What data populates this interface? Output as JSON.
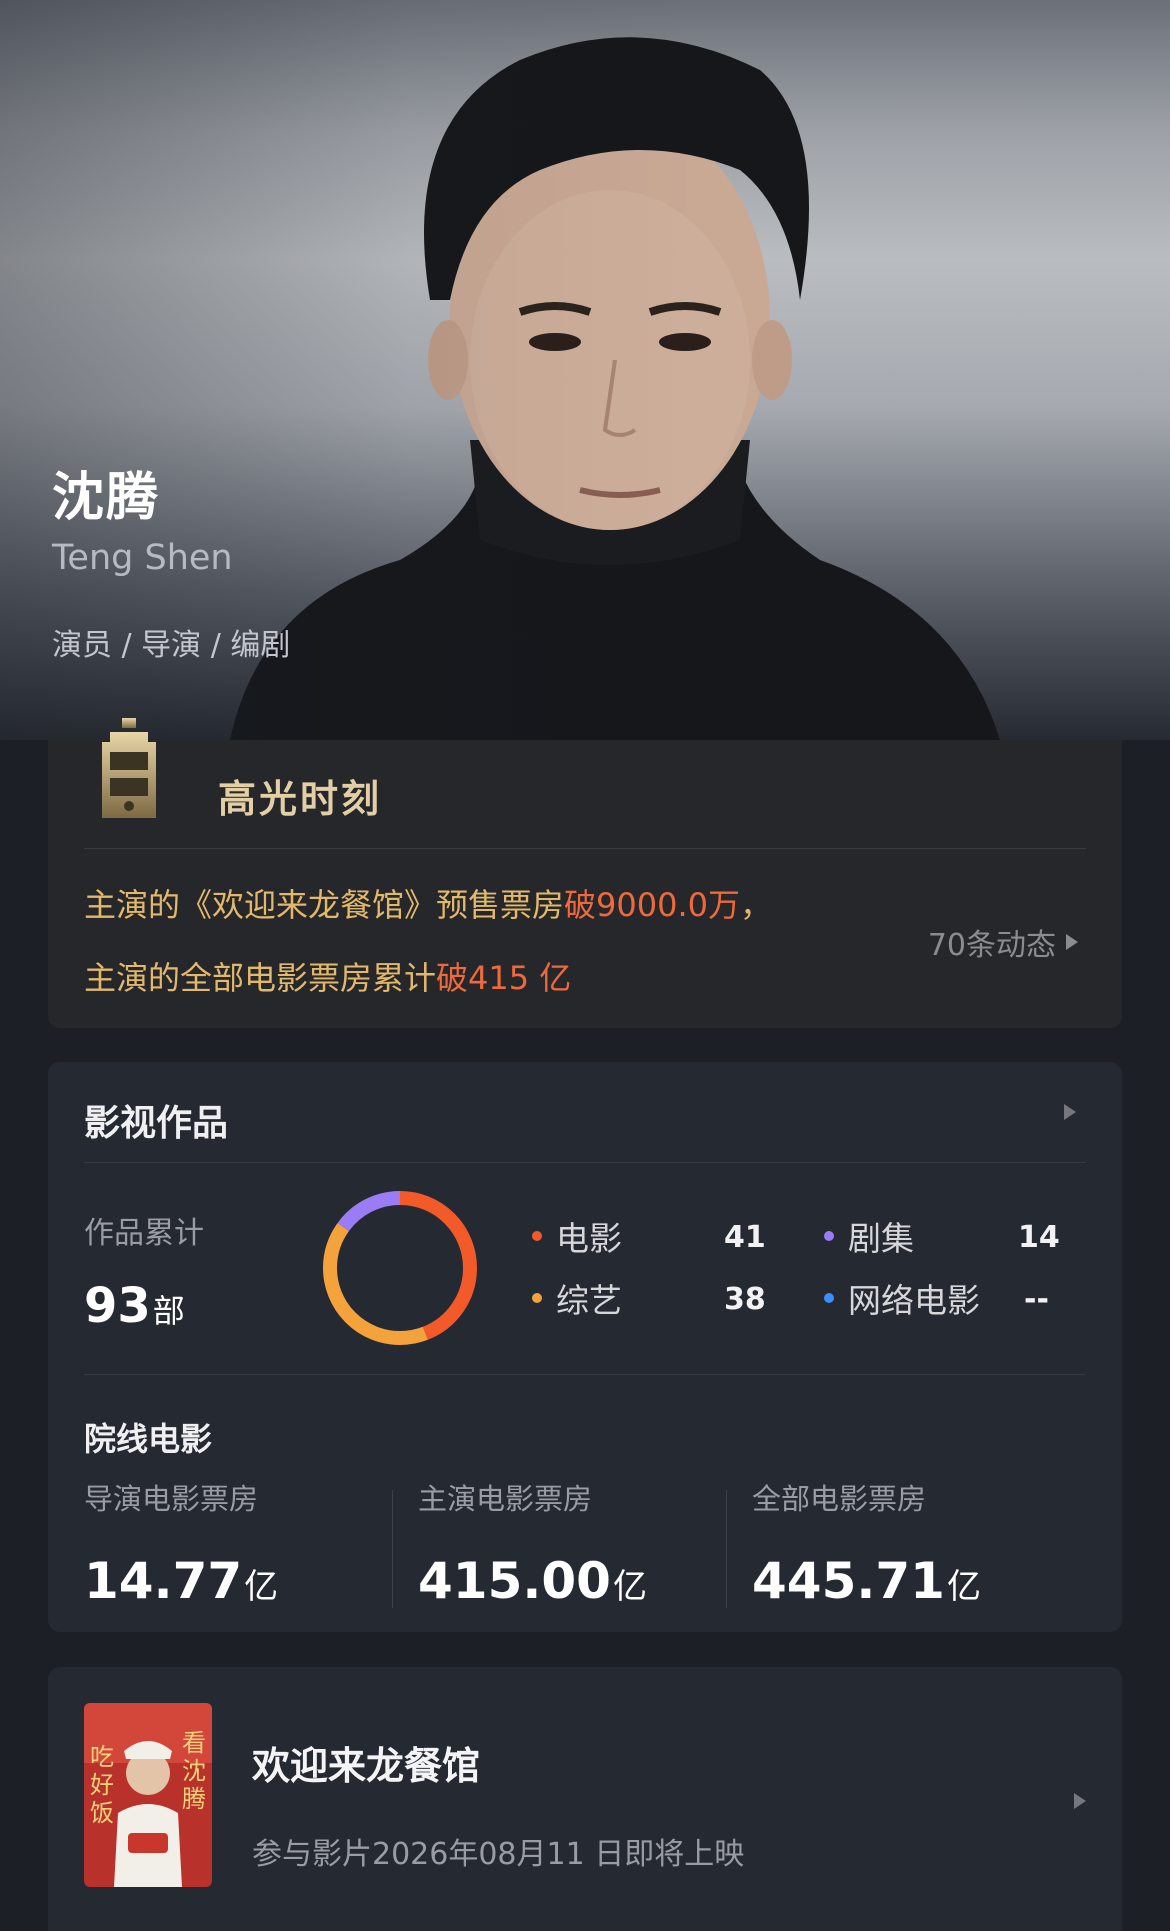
{
  "profile": {
    "name": "沈腾",
    "english_name": "Teng Shen",
    "roles": "演员 / 导演 / 编剧"
  },
  "highlight": {
    "title": "高光时刻",
    "line1_prefix": "主演的《欢迎来龙餐馆》预售票房",
    "line1_accent": "破9000.0万",
    "line1_suffix": "，",
    "line2_prefix": "主演的全部电影票房累计",
    "line2_accent": "破415 亿",
    "more_label": "70条动态",
    "accent_color": "#ee6a3c",
    "text_color": "#e2b86a"
  },
  "works": {
    "title": "影视作品",
    "count_label": "作品累计",
    "count_value": "93",
    "count_unit": "部",
    "legend": [
      {
        "label": "电影",
        "value": "41",
        "color": "#f25a2a"
      },
      {
        "label": "剧集",
        "value": "14",
        "color": "#9b7cf5"
      },
      {
        "label": "综艺",
        "value": "38",
        "color": "#f4a23c"
      },
      {
        "label": "网络电影",
        "value": "--",
        "color": "#3d8ef5"
      }
    ],
    "cinema_title": "院线电影",
    "box_office": [
      {
        "label": "导演电影票房",
        "value": "14.77",
        "unit": "亿"
      },
      {
        "label": "主演电影票房",
        "value": "415.00",
        "unit": "亿"
      },
      {
        "label": "全部电影票房",
        "value": "445.71",
        "unit": "亿"
      }
    ]
  },
  "upcoming": {
    "title": "欢迎来龙餐馆",
    "info": "参与影片2026年08月11 日即将上映",
    "poster_text_left": "吃好饭",
    "poster_text_right": "看沈腾"
  }
}
